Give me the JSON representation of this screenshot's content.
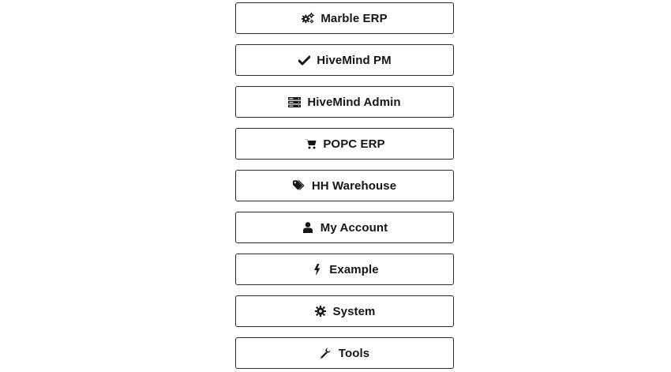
{
  "menu": {
    "items": [
      {
        "label": "Marble ERP",
        "icon": "cogs-icon"
      },
      {
        "label": "HiveMind PM",
        "icon": "check-icon"
      },
      {
        "label": "HiveMind Admin",
        "icon": "server-icon"
      },
      {
        "label": "POPC ERP",
        "icon": "shopping-cart-icon"
      },
      {
        "label": "HH Warehouse",
        "icon": "tags-icon"
      },
      {
        "label": "My Account",
        "icon": "user-icon"
      },
      {
        "label": "Example",
        "icon": "bolt-icon"
      },
      {
        "label": "System",
        "icon": "gear-icon"
      },
      {
        "label": "Tools",
        "icon": "wrench-icon"
      }
    ]
  },
  "colors": {
    "border": "#2b2b2b",
    "text": "#161616",
    "background": "#ffffff"
  }
}
